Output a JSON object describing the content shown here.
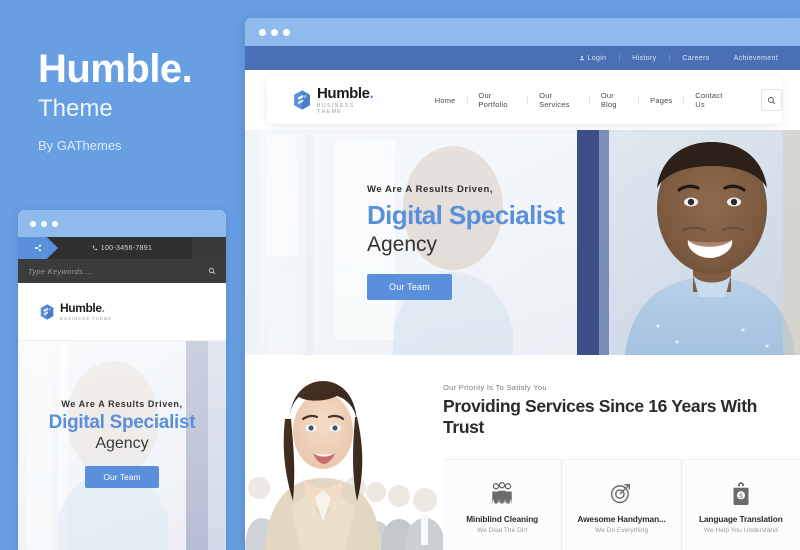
{
  "promo": {
    "title": "Humble.",
    "subtitle": "Theme",
    "byline": "By GAThemes"
  },
  "colors": {
    "page_background": "#689fe3",
    "titlebar": "#8ebbec",
    "topbar": "#4a6fb5",
    "accent": "#5a8fdc",
    "heading_dark": "#2b2b2b"
  },
  "desktop": {
    "topbar": {
      "links": [
        "Login",
        "History",
        "Careers",
        "Achievement"
      ],
      "separator": "|"
    },
    "logo": {
      "name": "Humble",
      "dot": ".",
      "tagline": "BUSINESS THEME"
    },
    "menu": [
      "Home",
      "Our Portfolio",
      "Our Services",
      "Our Blog",
      "Pages",
      "Contact Us"
    ],
    "search_icon": "search-icon",
    "hero": {
      "eyebrow": "We Are A Results Driven,",
      "headline": "Digital Specialist",
      "subhead": "Agency",
      "button": "Our Team"
    },
    "services": {
      "eyebrow": "Our Priority Is To Satisfy You",
      "title": "Providing Services Since 16 Years With Trust",
      "cards": [
        {
          "icon": "people-group-icon",
          "name": "Miniblind Cleaning",
          "desc": "We Deal The Dirt"
        },
        {
          "icon": "target-arrow-icon",
          "name": "Awesome Handyman...",
          "desc": "We Do Everything"
        },
        {
          "icon": "shopping-bag-dollar-icon",
          "name": "Language Translation",
          "desc": "We Help You Understand"
        }
      ]
    }
  },
  "mobile": {
    "share_icon": "share-icon",
    "phone": "100-3456-7891",
    "search_placeholder": "Type Keywords....",
    "logo": {
      "name": "Humble",
      "dot": ".",
      "tagline": "BUSINESS THEME"
    },
    "hero": {
      "eyebrow": "We Are A Results Driven,",
      "headline": "Digital Specialist",
      "subhead": "Agency",
      "button": "Our Team"
    }
  }
}
